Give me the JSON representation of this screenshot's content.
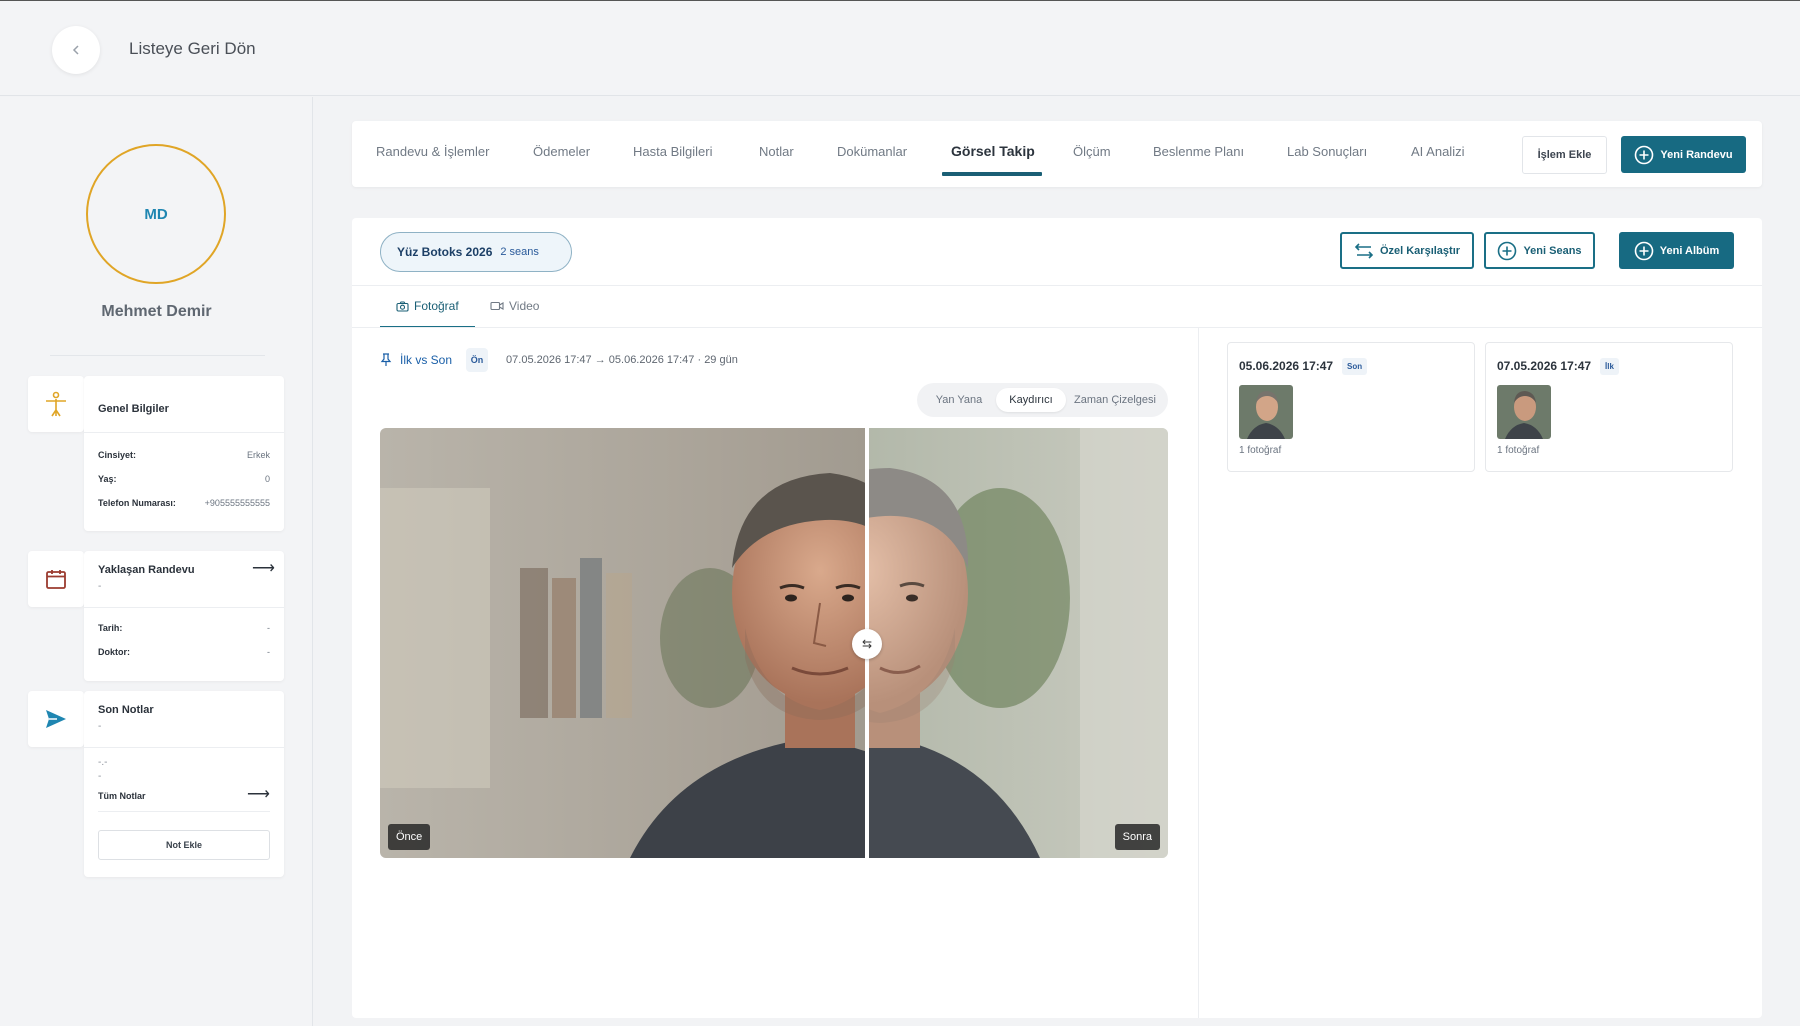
{
  "header": {
    "back_label": "Listeye Geri Dön"
  },
  "patient": {
    "initials": "MD",
    "name": "Mehmet Demir"
  },
  "general": {
    "title": "Genel Bilgiler",
    "rows": [
      {
        "label": "Cinsiyet:",
        "value": "Erkek"
      },
      {
        "label": "Yaş:",
        "value": "0"
      },
      {
        "label": "Telefon Numarası:",
        "value": "+905555555555"
      }
    ]
  },
  "upcoming": {
    "title": "Yaklaşan Randevu",
    "subtitle": "-",
    "rows": [
      {
        "label": "Tarih:",
        "value": "-"
      },
      {
        "label": "Doktor:",
        "value": "-"
      }
    ]
  },
  "notes": {
    "title": "Son Notlar",
    "subtitle": "-",
    "line1": "-.-",
    "line2": "-",
    "all_label": "Tüm Notlar",
    "add_label": "Not Ekle"
  },
  "tabs": [
    "Randevu & İşlemler",
    "Ödemeler",
    "Hasta Bilgileri",
    "Notlar",
    "Dokümanlar",
    "Görsel Takip",
    "Ölçüm",
    "Beslenme Planı",
    "Lab Sonuçları",
    "AI Analizi"
  ],
  "active_tab": "Görsel Takip",
  "actions": {
    "add_procedure": "İşlem Ekle",
    "new_appointment": "Yeni Randevu"
  },
  "album": {
    "name": "Yüz Botoks 2026",
    "count": "2 seans",
    "compare_label": "Özel Karşılaştır",
    "new_session_label": "Yeni Seans",
    "new_album_label": "Yeni Albüm"
  },
  "media_tabs": {
    "photo": "Fotoğraf",
    "video": "Video"
  },
  "comparison": {
    "title": "İlk vs Son",
    "view_badge": "Ön",
    "range": "07.05.2026 17:47 → 05.06.2026 17:47 · 29 gün",
    "modes": [
      "Yan Yana",
      "Kaydırıcı",
      "Zaman Çizelgesi"
    ],
    "active_mode": "Kaydırıcı",
    "before_label": "Önce",
    "after_label": "Sonra",
    "slider_position": 0.62
  },
  "sessions": [
    {
      "date": "05.06.2026 17:47",
      "badge": "Son",
      "photos": "1 fotoğraf"
    },
    {
      "date": "07.05.2026 17:47",
      "badge": "İlk",
      "photos": "1 fotoğraf"
    }
  ],
  "colors": {
    "primary": "#176a82",
    "accent_ring": "#e0a526",
    "link": "#1a5fa8"
  }
}
